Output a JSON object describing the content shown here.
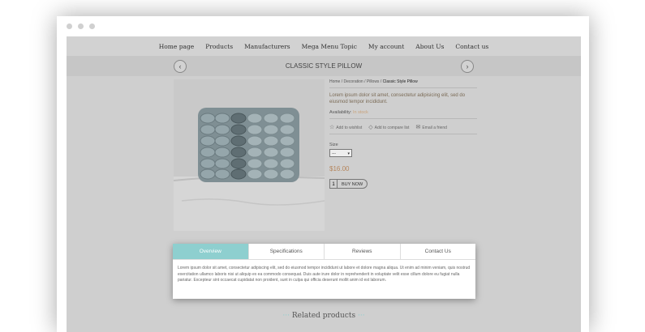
{
  "nav": {
    "items": [
      "Home page",
      "Products",
      "Manufacturers",
      "Mega Menu Topic",
      "My account",
      "About Us",
      "Contact us"
    ]
  },
  "product": {
    "title": "CLASSIC STYLE PILLOW",
    "breadcrumb": [
      "Home",
      "Decoration",
      "Pillows",
      "Classic Style Pillow"
    ],
    "breadcrumb_sep": "/",
    "short_description": "Lorem ipsum dolor sit amet, consectetur adipisicing elit, sed do eiusmod tempor incididunt.",
    "availability_label": "Availability:",
    "availability_value": "In stock",
    "actions": {
      "wishlist": "Add to wishlist",
      "compare": "Add to compare list",
      "email": "Email a friend"
    },
    "size_label": "Size",
    "size_selected": "---",
    "price": "$16.00",
    "quantity": "1",
    "buy_label": "BUY NOW"
  },
  "tabs": {
    "items": [
      "Overview",
      "Specifications",
      "Reviews",
      "Contact Us"
    ],
    "active": "Overview",
    "overview_text": "Lorem ipsum dolor sit amet, consectetur adipiscing elit, sed do eiusmod tempor incididunt ut labore et dolore magna aliqua. Ut enim ad minim veniam, quis nostrud exercitation ullamco laboris nisi ut aliquip ex ea commodo consequat. Duis aute irure dolor in reprehenderit in voluptate velit esse cillum dolore eu fugiat nulla pariatur. Excepteur sint occaecat cupidatat non proident, sunt in culpa qui officia deserunt mollit anim id est laborum."
  },
  "related": {
    "title": "Related products"
  },
  "colors": {
    "accent": "#8ecfcf",
    "price": "#b5865d",
    "page_bg": "#cfcfcf"
  },
  "icons": {
    "prev": "chevron-left-icon",
    "next": "chevron-right-icon",
    "wishlist": "star-icon",
    "compare": "tag-icon",
    "email": "envelope-icon"
  }
}
